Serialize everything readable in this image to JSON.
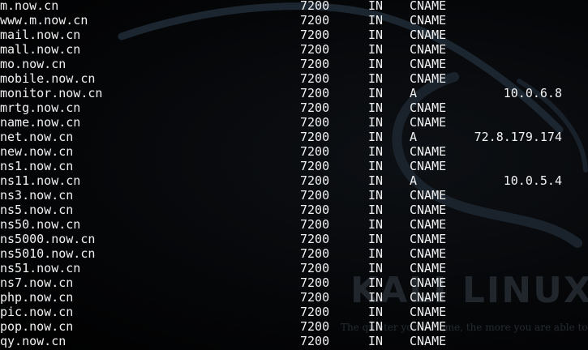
{
  "wallpaper": {
    "brand_text": "KALI LINUX",
    "tagline": "The quieter you become, the more you are able to hear"
  },
  "records": [
    {
      "host": "m.now.cn",
      "ttl": "7200",
      "class": "IN",
      "type": "CNAME",
      "value": ""
    },
    {
      "host": "www.m.now.cn",
      "ttl": "7200",
      "class": "IN",
      "type": "CNAME",
      "value": ""
    },
    {
      "host": "mail.now.cn",
      "ttl": "7200",
      "class": "IN",
      "type": "CNAME",
      "value": ""
    },
    {
      "host": "mall.now.cn",
      "ttl": "7200",
      "class": "IN",
      "type": "CNAME",
      "value": ""
    },
    {
      "host": "mo.now.cn",
      "ttl": "7200",
      "class": "IN",
      "type": "CNAME",
      "value": ""
    },
    {
      "host": "mobile.now.cn",
      "ttl": "7200",
      "class": "IN",
      "type": "CNAME",
      "value": ""
    },
    {
      "host": "monitor.now.cn",
      "ttl": "7200",
      "class": "IN",
      "type": "A",
      "value": "10.0.6.8"
    },
    {
      "host": "mrtg.now.cn",
      "ttl": "7200",
      "class": "IN",
      "type": "CNAME",
      "value": ""
    },
    {
      "host": "name.now.cn",
      "ttl": "7200",
      "class": "IN",
      "type": "CNAME",
      "value": ""
    },
    {
      "host": "net.now.cn",
      "ttl": "7200",
      "class": "IN",
      "type": "A",
      "value": "72.8.179.174"
    },
    {
      "host": "new.now.cn",
      "ttl": "7200",
      "class": "IN",
      "type": "CNAME",
      "value": ""
    },
    {
      "host": "ns1.now.cn",
      "ttl": "7200",
      "class": "IN",
      "type": "CNAME",
      "value": ""
    },
    {
      "host": "ns11.now.cn",
      "ttl": "7200",
      "class": "IN",
      "type": "A",
      "value": "10.0.5.4"
    },
    {
      "host": "ns3.now.cn",
      "ttl": "7200",
      "class": "IN",
      "type": "CNAME",
      "value": ""
    },
    {
      "host": "ns5.now.cn",
      "ttl": "7200",
      "class": "IN",
      "type": "CNAME",
      "value": ""
    },
    {
      "host": "ns50.now.cn",
      "ttl": "7200",
      "class": "IN",
      "type": "CNAME",
      "value": ""
    },
    {
      "host": "ns5000.now.cn",
      "ttl": "7200",
      "class": "IN",
      "type": "CNAME",
      "value": ""
    },
    {
      "host": "ns5010.now.cn",
      "ttl": "7200",
      "class": "IN",
      "type": "CNAME",
      "value": ""
    },
    {
      "host": "ns51.now.cn",
      "ttl": "7200",
      "class": "IN",
      "type": "CNAME",
      "value": ""
    },
    {
      "host": "ns7.now.cn",
      "ttl": "7200",
      "class": "IN",
      "type": "CNAME",
      "value": ""
    },
    {
      "host": "php.now.cn",
      "ttl": "7200",
      "class": "IN",
      "type": "CNAME",
      "value": ""
    },
    {
      "host": "pic.now.cn",
      "ttl": "7200",
      "class": "IN",
      "type": "CNAME",
      "value": ""
    },
    {
      "host": "pop.now.cn",
      "ttl": "7200",
      "class": "IN",
      "type": "CNAME",
      "value": ""
    },
    {
      "host": "qy.now.cn",
      "ttl": "7200",
      "class": "IN",
      "type": "CNAME",
      "value": ""
    }
  ]
}
